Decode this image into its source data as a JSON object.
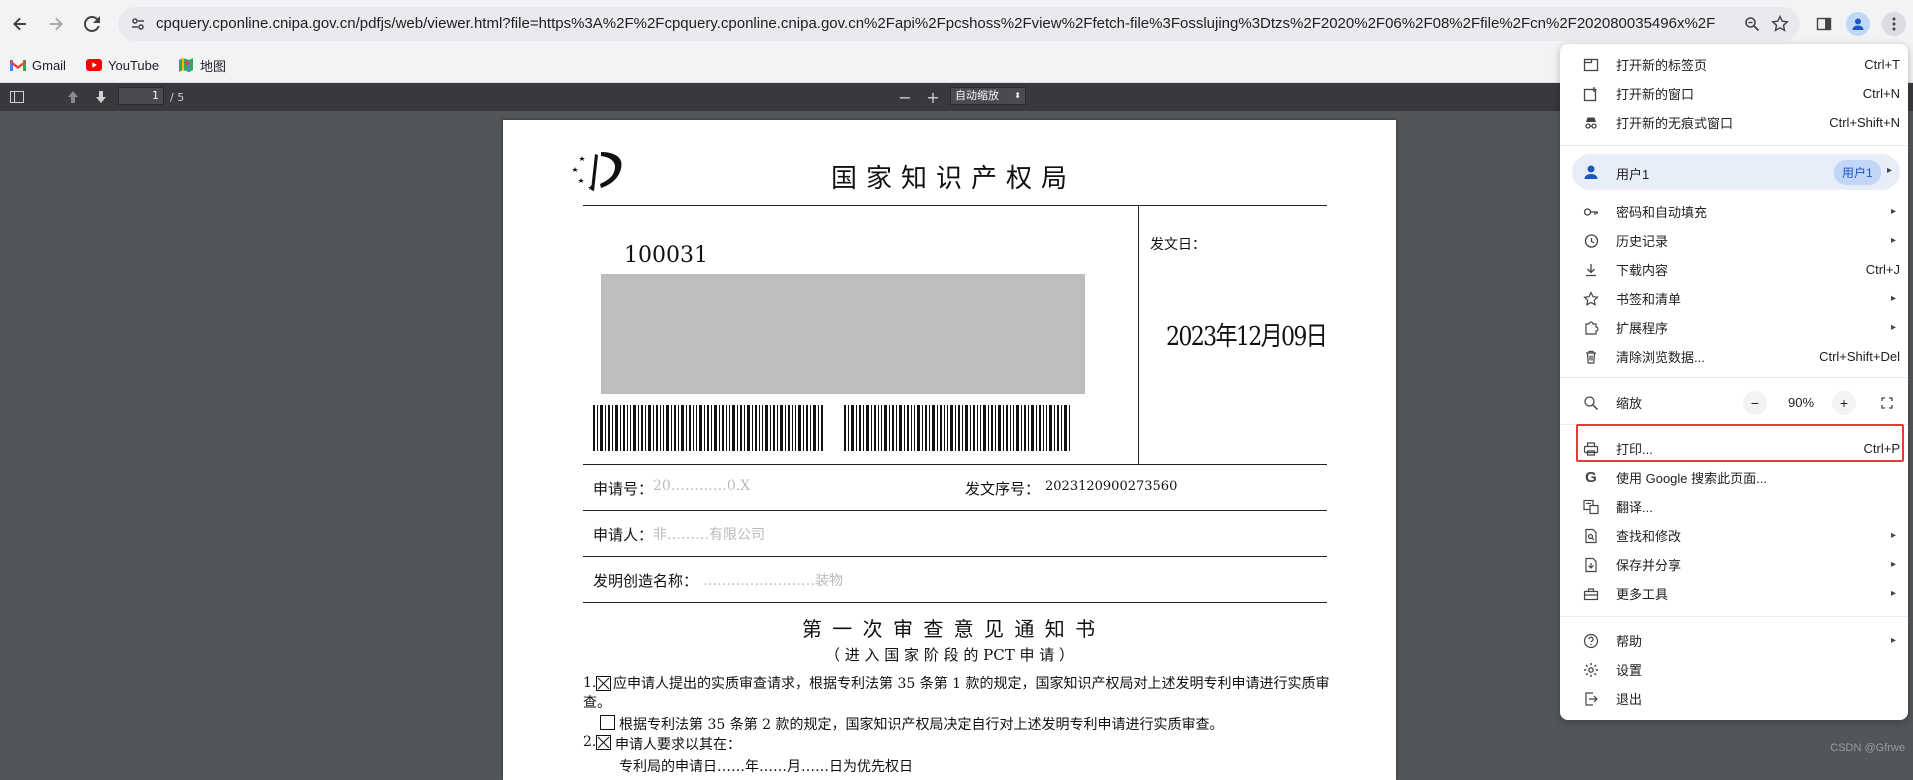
{
  "browser": {
    "url": "cpquery.cponline.cnipa.gov.cn/pdfjs/web/viewer.html?file=https%3A%2F%2Fcpquery.cponline.cnipa.gov.cn%2Fapi%2Fpcshoss%2Fview%2Ffetch-file%3Fosslujing%3Dtzs%2F2020%2F06%2F08%2Ffile%2Fcn%2F202080035496x%2F10...",
    "bookmarks": [
      {
        "label": "Gmail"
      },
      {
        "label": "YouTube"
      },
      {
        "label": "地图"
      }
    ]
  },
  "pdf_toolbar": {
    "page_current": "1",
    "page_total": "/ 5",
    "zoom_minus": "−",
    "zoom_plus": "+",
    "zoom_label": "自动缩放"
  },
  "document": {
    "office": "国家知识产权局",
    "postcode": "100031",
    "send_date_label": "发文日：",
    "send_date": "2023年12月09日",
    "app_no_label": "申请号：",
    "app_no_value": "20…………0.X",
    "doc_no_label": "发文序号：",
    "doc_no_value": "2023120900273560",
    "applicant_label": "申请人：",
    "applicant_value": "非………有限公司",
    "invention_label": "发明创造名称：",
    "invention_value": "……………………装物",
    "title": "第 一 次 审 查 意 见 通 知 书",
    "subtitle": "（ 进 入 国 家 阶 段 的 PCT 申 请 ）",
    "item1_num": "1.",
    "item1_text": "应申请人提出的实质审查请求，根据专利法第 35 条第 1 款的规定，国家知识产权局对上述发明专利申请进行实质审查。",
    "item1b_text": "根据专利法第 35 条第 2 款的规定，国家知识产权局决定自行对上述发明专利申请进行实质审查。",
    "item2_num": "2.",
    "item2_text": "申请人要求以其在：",
    "item2_cont": "专利局的申请日……年……月……日为优先权日"
  },
  "menu": {
    "new_tab": "打开新的标签页",
    "new_tab_short": "Ctrl+T",
    "new_window": "打开新的窗口",
    "new_window_short": "Ctrl+N",
    "incognito": "打开新的无痕式窗口",
    "incognito_short": "Ctrl+Shift+N",
    "profile": "用户1",
    "profile_badge": "用户1",
    "passwords": "密码和自动填充",
    "history": "历史记录",
    "downloads": "下载内容",
    "downloads_short": "Ctrl+J",
    "bookmarks": "书签和清单",
    "extensions": "扩展程序",
    "clear_data": "清除浏览数据...",
    "clear_data_short": "Ctrl+Shift+Del",
    "zoom": "缩放",
    "zoom_value": "90%",
    "print": "打印...",
    "print_short": "Ctrl+P",
    "google_search": "使用 Google 搜索此页面...",
    "translate": "翻译...",
    "find": "查找和修改",
    "save_share": "保存并分享",
    "more_tools": "更多工具",
    "help": "帮助",
    "settings": "设置",
    "exit": "退出",
    "highlight_color": "#e53935"
  },
  "watermark": "CSDN @Gfrwe"
}
